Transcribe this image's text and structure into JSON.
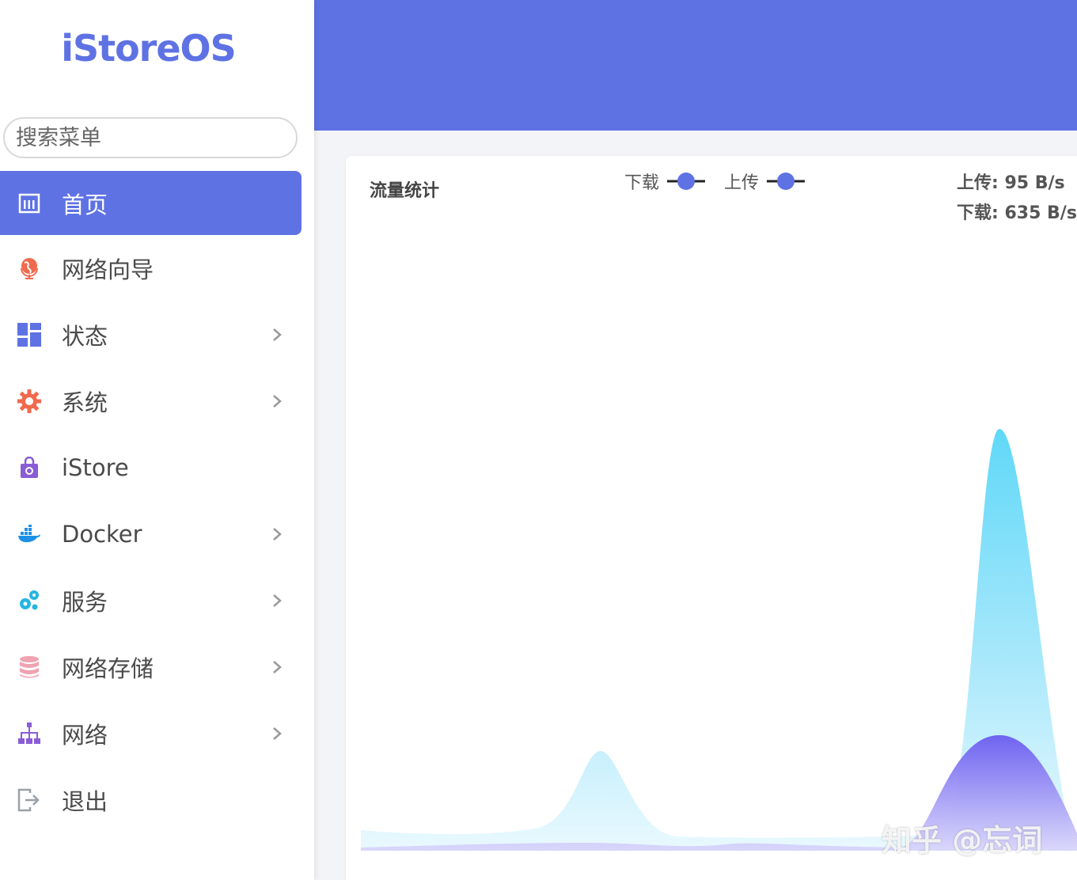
{
  "sidebar": {
    "logo": "iStoreOS",
    "search": {
      "placeholder": "搜索菜单",
      "value": ""
    },
    "items": [
      {
        "label": "首页",
        "icon": "dashboard-icon",
        "active": true,
        "has_submenu": false
      },
      {
        "label": "网络向导",
        "icon": "globe-icon",
        "active": false,
        "has_submenu": false
      },
      {
        "label": "状态",
        "icon": "status-grid-icon",
        "active": false,
        "has_submenu": true
      },
      {
        "label": "系统",
        "icon": "gear-icon",
        "active": false,
        "has_submenu": true
      },
      {
        "label": "iStore",
        "icon": "shopping-bag-icon",
        "active": false,
        "has_submenu": false
      },
      {
        "label": "Docker",
        "icon": "docker-whale-icon",
        "active": false,
        "has_submenu": true
      },
      {
        "label": "服务",
        "icon": "gears-icon",
        "active": false,
        "has_submenu": true
      },
      {
        "label": "网络存储",
        "icon": "database-icon",
        "active": false,
        "has_submenu": true
      },
      {
        "label": "网络",
        "icon": "network-tree-icon",
        "active": false,
        "has_submenu": true
      },
      {
        "label": "退出",
        "icon": "logout-icon",
        "active": false,
        "has_submenu": false
      }
    ]
  },
  "traffic": {
    "title": "流量统计",
    "legend": [
      {
        "label": "下载",
        "color": "#5e72e4"
      },
      {
        "label": "上传",
        "color": "#5e72e4"
      }
    ],
    "upload_label": "上传: 95 B/s",
    "download_label": "下载: 635 B/s"
  },
  "watermark": "知乎 @忘词",
  "colors": {
    "accent": "#5e72e4",
    "download_fill_top": "#62d9f8",
    "upload_fill_top": "#6a5cf0"
  }
}
